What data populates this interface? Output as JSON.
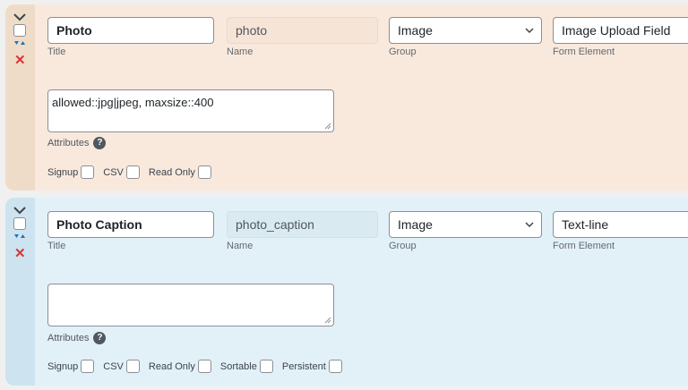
{
  "fields": [
    {
      "title": "Photo",
      "name": "photo",
      "group": "Image",
      "form_element": "Image Upload Field",
      "attributes_value": "allowed::jpg|jpeg, maxsize::400",
      "options": [
        "Signup",
        "CSV",
        "Read Only"
      ]
    },
    {
      "title": "Photo Caption",
      "name": "photo_caption",
      "group": "Image",
      "form_element": "Text-line",
      "attributes_value": "",
      "options": [
        "Signup",
        "CSV",
        "Read Only",
        "Sortable",
        "Persistent"
      ]
    }
  ],
  "labels": {
    "title": "Title",
    "name": "Name",
    "group": "Group",
    "form_element": "Form Element",
    "attributes": "Attributes",
    "help": "?"
  },
  "icons": [
    "chevron-down-icon",
    "sort-arrows-icon",
    "delete-x-icon",
    "help-icon"
  ],
  "colors": {
    "panel1": "#f9e9dd",
    "panel2": "#e2f1f7",
    "delete": "#d63638",
    "sort": "#2271b1"
  }
}
